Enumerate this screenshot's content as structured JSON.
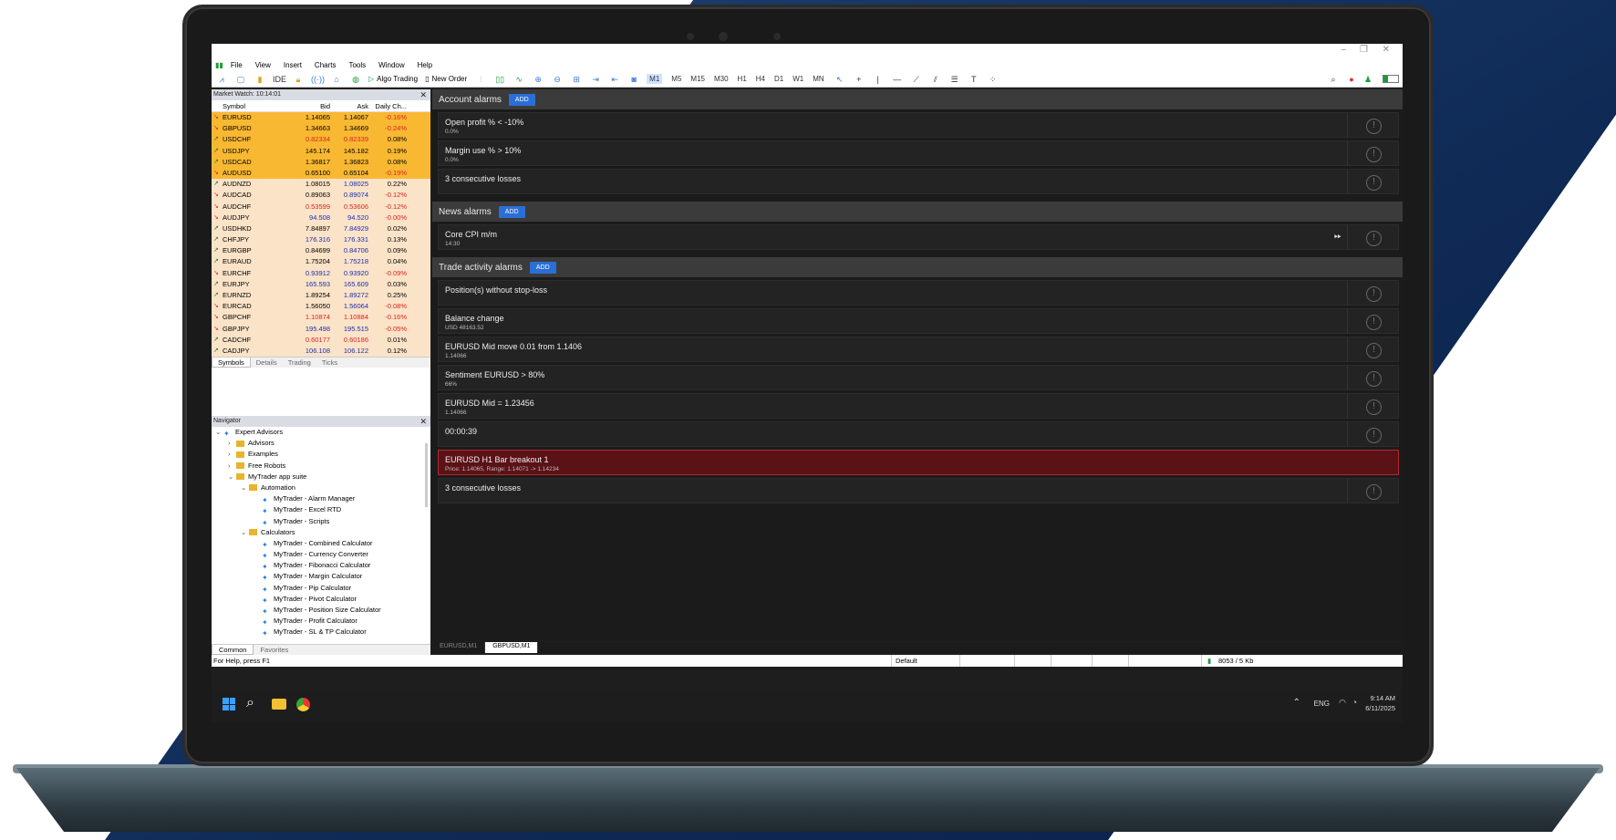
{
  "menu": [
    "File",
    "View",
    "Insert",
    "Charts",
    "Tools",
    "Window",
    "Help"
  ],
  "toolbar": {
    "ide": "IDE",
    "algo": "Algo Trading",
    "new_order": "New Order",
    "timeframes": [
      "M1",
      "M5",
      "M15",
      "M30",
      "H1",
      "H4",
      "D1",
      "W1",
      "MN"
    ],
    "selected_tf": "M1"
  },
  "market_watch": {
    "title": "Market Watch: 10:14:01",
    "headers": {
      "symbol": "Symbol",
      "bid": "Bid",
      "ask": "Ask",
      "daily": "Daily Ch..."
    },
    "rows": [
      {
        "s": "EURUSD",
        "b": "1.14065",
        "a": "1.14067",
        "d": "-0.16%",
        "hl": true,
        "bc": "",
        "ac": "",
        "dc": "neg"
      },
      {
        "s": "GBPUSD",
        "b": "1.34663",
        "a": "1.34669",
        "d": "-0.24%",
        "hl": true,
        "bc": "",
        "ac": "",
        "dc": "neg"
      },
      {
        "s": "USDCHF",
        "b": "0.82334",
        "a": "0.82339",
        "d": "0.08%",
        "hl": true,
        "bc": "neg",
        "ac": "neg",
        "dc": ""
      },
      {
        "s": "USDJPY",
        "b": "145.174",
        "a": "145.182",
        "d": "0.19%",
        "hl": true,
        "bc": "",
        "ac": "",
        "dc": ""
      },
      {
        "s": "USDCAD",
        "b": "1.36817",
        "a": "1.36823",
        "d": "0.08%",
        "hl": true,
        "bc": "",
        "ac": "",
        "dc": ""
      },
      {
        "s": "AUDUSD",
        "b": "0.65100",
        "a": "0.65104",
        "d": "-0.19%",
        "hl": true,
        "bc": "",
        "ac": "",
        "dc": "neg"
      },
      {
        "s": "AUDNZD",
        "b": "1.08015",
        "a": "1.08025",
        "d": "0.22%",
        "hl": false,
        "bc": "",
        "ac": "blu",
        "dc": ""
      },
      {
        "s": "AUDCAD",
        "b": "0.89063",
        "a": "0.89074",
        "d": "-0.12%",
        "hl": false,
        "bc": "",
        "ac": "blu",
        "dc": "neg"
      },
      {
        "s": "AUDCHF",
        "b": "0.53599",
        "a": "0.53606",
        "d": "-0.12%",
        "hl": false,
        "bc": "neg",
        "ac": "neg",
        "dc": "neg"
      },
      {
        "s": "AUDJPY",
        "b": "94.508",
        "a": "94.520",
        "d": "-0.00%",
        "hl": false,
        "bc": "blu",
        "ac": "blu",
        "dc": "neg"
      },
      {
        "s": "USDHKD",
        "b": "7.84897",
        "a": "7.84929",
        "d": "0.02%",
        "hl": false,
        "bc": "",
        "ac": "blu",
        "dc": ""
      },
      {
        "s": "CHFJPY",
        "b": "176.316",
        "a": "176.331",
        "d": "0.13%",
        "hl": false,
        "bc": "blu",
        "ac": "blu",
        "dc": ""
      },
      {
        "s": "EURGBP",
        "b": "0.84699",
        "a": "0.84706",
        "d": "0.09%",
        "hl": false,
        "bc": "",
        "ac": "blu",
        "dc": ""
      },
      {
        "s": "EURAUD",
        "b": "1.75204",
        "a": "1.75218",
        "d": "0.04%",
        "hl": false,
        "bc": "",
        "ac": "blu",
        "dc": ""
      },
      {
        "s": "EURCHF",
        "b": "0.93912",
        "a": "0.93920",
        "d": "-0.09%",
        "hl": false,
        "bc": "blu",
        "ac": "blu",
        "dc": "neg"
      },
      {
        "s": "EURJPY",
        "b": "165.593",
        "a": "165.609",
        "d": "0.03%",
        "hl": false,
        "bc": "blu",
        "ac": "blu",
        "dc": ""
      },
      {
        "s": "EURNZD",
        "b": "1.89254",
        "a": "1.89272",
        "d": "0.25%",
        "hl": false,
        "bc": "",
        "ac": "blu",
        "dc": ""
      },
      {
        "s": "EURCAD",
        "b": "1.56050",
        "a": "1.56064",
        "d": "-0.08%",
        "hl": false,
        "bc": "",
        "ac": "blu",
        "dc": "neg"
      },
      {
        "s": "GBPCHF",
        "b": "1.10874",
        "a": "1.10884",
        "d": "-0.16%",
        "hl": false,
        "bc": "neg",
        "ac": "neg",
        "dc": "neg"
      },
      {
        "s": "GBPJPY",
        "b": "195.498",
        "a": "195.515",
        "d": "-0.05%",
        "hl": false,
        "bc": "blu",
        "ac": "blu",
        "dc": "neg"
      },
      {
        "s": "CADCHF",
        "b": "0.60177",
        "a": "0.60186",
        "d": "0.01%",
        "hl": false,
        "bc": "neg",
        "ac": "neg",
        "dc": ""
      },
      {
        "s": "CADJPY",
        "b": "106.108",
        "a": "106.122",
        "d": "0.12%",
        "hl": false,
        "bc": "blu",
        "ac": "blu",
        "dc": ""
      }
    ],
    "tabs": [
      "Symbols",
      "Details",
      "Trading",
      "Ticks"
    ]
  },
  "navigator": {
    "title": "Navigator",
    "items": [
      {
        "label": "Expert Advisors",
        "level": 0,
        "type": "ea",
        "exp": "v"
      },
      {
        "label": "Advisors",
        "level": 1,
        "type": "folder",
        "exp": ">"
      },
      {
        "label": "Examples",
        "level": 1,
        "type": "folder",
        "exp": ">"
      },
      {
        "label": "Free Robots",
        "level": 1,
        "type": "folder",
        "exp": ">"
      },
      {
        "label": "MyTrader app suite",
        "level": 1,
        "type": "folder",
        "exp": "v"
      },
      {
        "label": "Automation",
        "level": 2,
        "type": "folder",
        "exp": "v"
      },
      {
        "label": "MyTrader - Alarm Manager",
        "level": 3,
        "type": "ea",
        "exp": ""
      },
      {
        "label": "MyTrader - Excel RTD",
        "level": 3,
        "type": "ea",
        "exp": ""
      },
      {
        "label": "MyTrader - Scripts",
        "level": 3,
        "type": "ea",
        "exp": ""
      },
      {
        "label": "Calculators",
        "level": 2,
        "type": "folder",
        "exp": "v"
      },
      {
        "label": "MyTrader - Combined Calculator",
        "level": 3,
        "type": "ea",
        "exp": ""
      },
      {
        "label": "MyTrader - Currency Converter",
        "level": 3,
        "type": "ea",
        "exp": ""
      },
      {
        "label": "MyTrader - Fibonacci Calculator",
        "level": 3,
        "type": "ea",
        "exp": ""
      },
      {
        "label": "MyTrader - Margin Calculator",
        "level": 3,
        "type": "ea",
        "exp": ""
      },
      {
        "label": "MyTrader - Pip Calculator",
        "level": 3,
        "type": "ea",
        "exp": ""
      },
      {
        "label": "MyTrader - Pivot Calculator",
        "level": 3,
        "type": "ea",
        "exp": ""
      },
      {
        "label": "MyTrader - Position Size Calculator",
        "level": 3,
        "type": "ea",
        "exp": ""
      },
      {
        "label": "MyTrader - Profit Calculator",
        "level": 3,
        "type": "ea",
        "exp": ""
      },
      {
        "label": "MyTrader - SL & TP Calculator",
        "level": 3,
        "type": "ea",
        "exp": ""
      }
    ],
    "tabs": [
      "Common",
      "Favorites"
    ]
  },
  "sections": [
    {
      "title": "Account alarms",
      "add": "ADD",
      "alarms": [
        {
          "t": "Open profit % < -10%",
          "s": "0.0%"
        },
        {
          "t": "Margin use % > 10%",
          "s": "0.0%"
        },
        {
          "t": "3 consecutive losses",
          "s": ""
        }
      ]
    },
    {
      "title": "News alarms",
      "add": "ADD",
      "alarms": [
        {
          "t": "Core CPI m/m",
          "s": "14:30",
          "ff": true
        }
      ]
    },
    {
      "title": "Trade activity alarms",
      "add": "ADD",
      "alarms": [
        {
          "t": "Position(s) without stop-loss",
          "s": ""
        },
        {
          "t": "Balance change",
          "s": "USD 48163.52"
        },
        {
          "t": "EURUSD Mid move 0.01 from 1.1406",
          "s": "1.14066"
        },
        {
          "t": "Sentiment EURUSD > 80%",
          "s": "66%"
        },
        {
          "t": "EURUSD Mid = 1.23456",
          "s": "1.14066"
        },
        {
          "t": "00:00:39",
          "s": ""
        },
        {
          "t": "EURUSD H1 Bar breakout 1",
          "s": "Price: 1.14065, Range: 1.14071 -> 1.14234",
          "red": true
        },
        {
          "t": "3 consecutive losses",
          "s": ""
        }
      ]
    }
  ],
  "chart_tabs": [
    "EURUSD,M1",
    "GBPUSD,M1"
  ],
  "active_chart_tab": 1,
  "status": {
    "help": "For Help, press F1",
    "profile": "Default",
    "traffic": "8053 / 5 Kb"
  },
  "taskbar": {
    "lang": "ENG",
    "time": "9:14 AM",
    "date": "6/11/2025"
  }
}
